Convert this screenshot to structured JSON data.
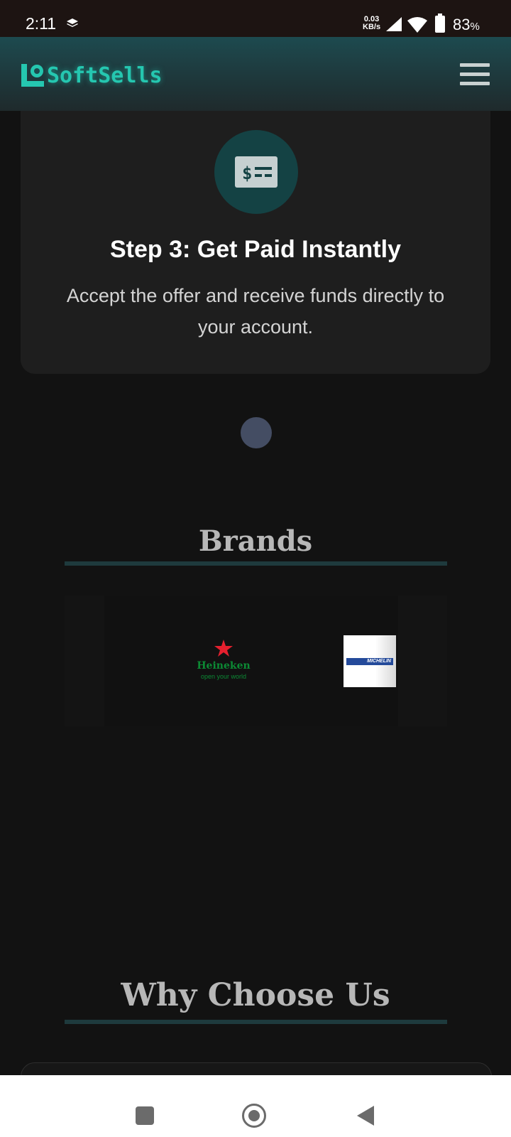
{
  "status_bar": {
    "time": "2:11",
    "net_speed_value": "0.03",
    "net_speed_unit": "KB/s",
    "battery": "83",
    "battery_unit": "%"
  },
  "header": {
    "logo_text": "SoftSells",
    "brand_color": "#25c7b0",
    "menu_icon": "hamburger-menu-icon"
  },
  "step": {
    "icon": "money-bill-icon",
    "title": "Step 3: Get Paid Instantly",
    "description": "Accept the offer and receive funds directly to your account."
  },
  "brands": {
    "title": "Brands",
    "items": [
      {
        "name": "Heineken",
        "tagline": "open your world"
      },
      {
        "name": "MICHELIN"
      }
    ]
  },
  "why": {
    "title": "Why Choose Us"
  },
  "nav": {
    "recents_icon": "recents-square-icon",
    "home_icon": "home-circle-icon",
    "back_icon": "back-triangle-icon"
  }
}
